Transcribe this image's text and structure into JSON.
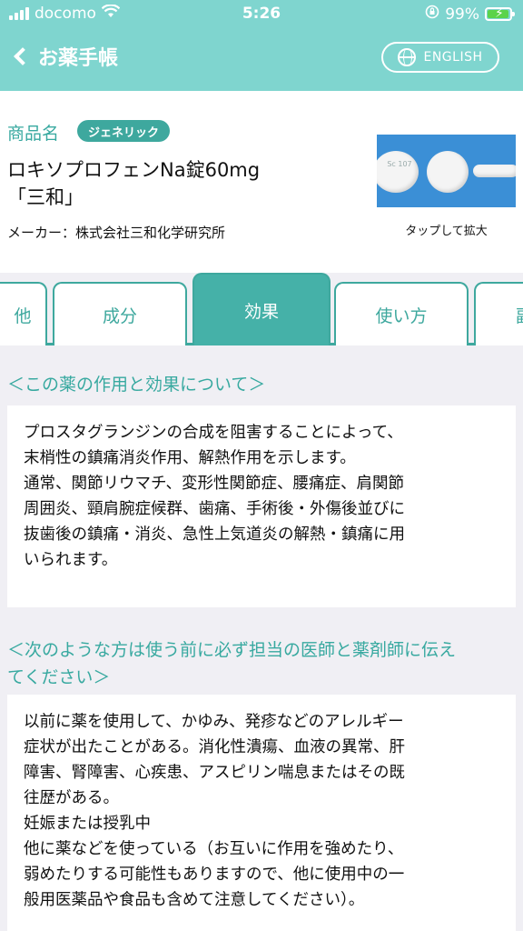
{
  "status": {
    "carrier": "docomo",
    "time": "5:26",
    "battery": "99%"
  },
  "nav": {
    "back_label": "お薬手帳",
    "language_button": "ENGLISH"
  },
  "product": {
    "label": "商品名",
    "badge": "ジェネリック",
    "name_line1": "ロキソプロフェンNa錠60mg",
    "name_line2": "「三和」",
    "maker": "メーカー：株式会社三和化学研究所",
    "tap_text": "タップして拡大",
    "pill_imprint": "Sc 107"
  },
  "tabs": [
    {
      "label": "他",
      "active": false
    },
    {
      "label": "成分",
      "active": false
    },
    {
      "label": "効果",
      "active": true
    },
    {
      "label": "使い方",
      "active": false
    },
    {
      "label": "副",
      "active": false
    }
  ],
  "sections": [
    {
      "heading": "＜この薬の作用と効果について＞",
      "body": "プロスタグランジンの合成を阻害することによって、\n末梢性の鎮痛消炎作用、解熱作用を示します。\n通常、関節リウマチ、変形性関節症、腰痛症、肩関節\n周囲炎、頸肩腕症候群、歯痛、手術後・外傷後並びに\n抜歯後の鎮痛・消炎、急性上気道炎の解熱・鎮痛に用\nいられます。"
    },
    {
      "heading_line1": "＜次のような方は使う前に必ず担当の医師と薬剤師に伝え",
      "heading_line2": "てください＞",
      "body": "以前に薬を使用して、かゆみ、発疹などのアレルギー\n症状が出たことがある。消化性潰瘍、血液の異常、肝\n障害、腎障害、心疾患、アスピリン喘息またはその既\n往歴がある。\n妊娠または授乳中\n他に薬などを使っている（お互いに作用を強めたり、\n弱めたりする可能性もありますので、他に使用中の一\n般用医薬品や食品も含めて注意してください）。"
    }
  ],
  "colors": {
    "header": "#7fd5cf",
    "accent": "#3ea89e",
    "background": "#f0eff4"
  }
}
